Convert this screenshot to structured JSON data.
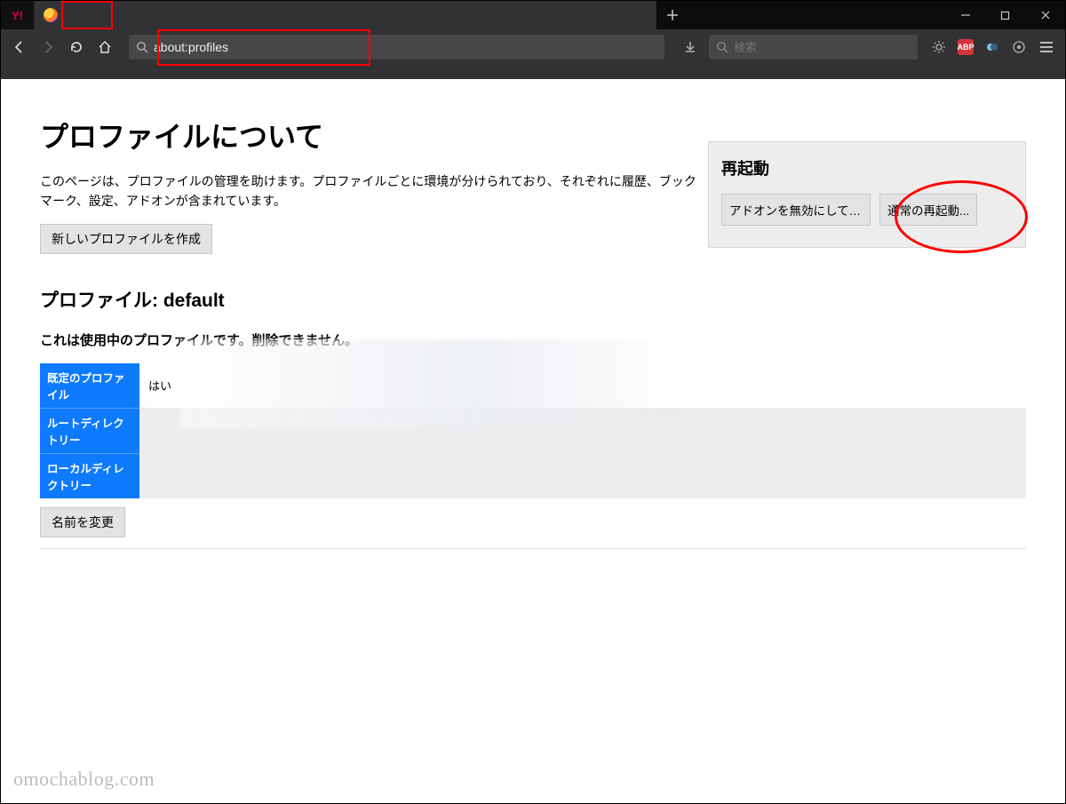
{
  "tabs": {
    "yahoo_icon_text": "Y!"
  },
  "nav": {
    "url": "about:profiles",
    "search_placeholder": "検索"
  },
  "ext": {
    "abp_label": "ABP"
  },
  "page": {
    "title": "プロファイルについて",
    "intro": "このページは、プロファイルの管理を助けます。プロファイルごとに環境が分けられており、それぞれに履歴、ブックマーク、設定、アドオンが含まれています。",
    "create_profile_btn": "新しいプロファイルを作成",
    "restart": {
      "heading": "再起動",
      "disable_addons_btn": "アドオンを無効にして再起動...",
      "normal_restart_btn": "通常の再起動..."
    },
    "profile": {
      "heading": "プロファイル: default",
      "in_use_notice": "これは使用中のプロファイルです。削除できません。",
      "rows": {
        "default_label": "既定のプロファイル",
        "default_value": "はい",
        "root_label": "ルートディレクトリー",
        "root_value": "",
        "local_label": "ローカルディレクトリー",
        "local_value": ""
      },
      "rename_btn": "名前を変更"
    }
  },
  "watermark": "omochablog.com"
}
